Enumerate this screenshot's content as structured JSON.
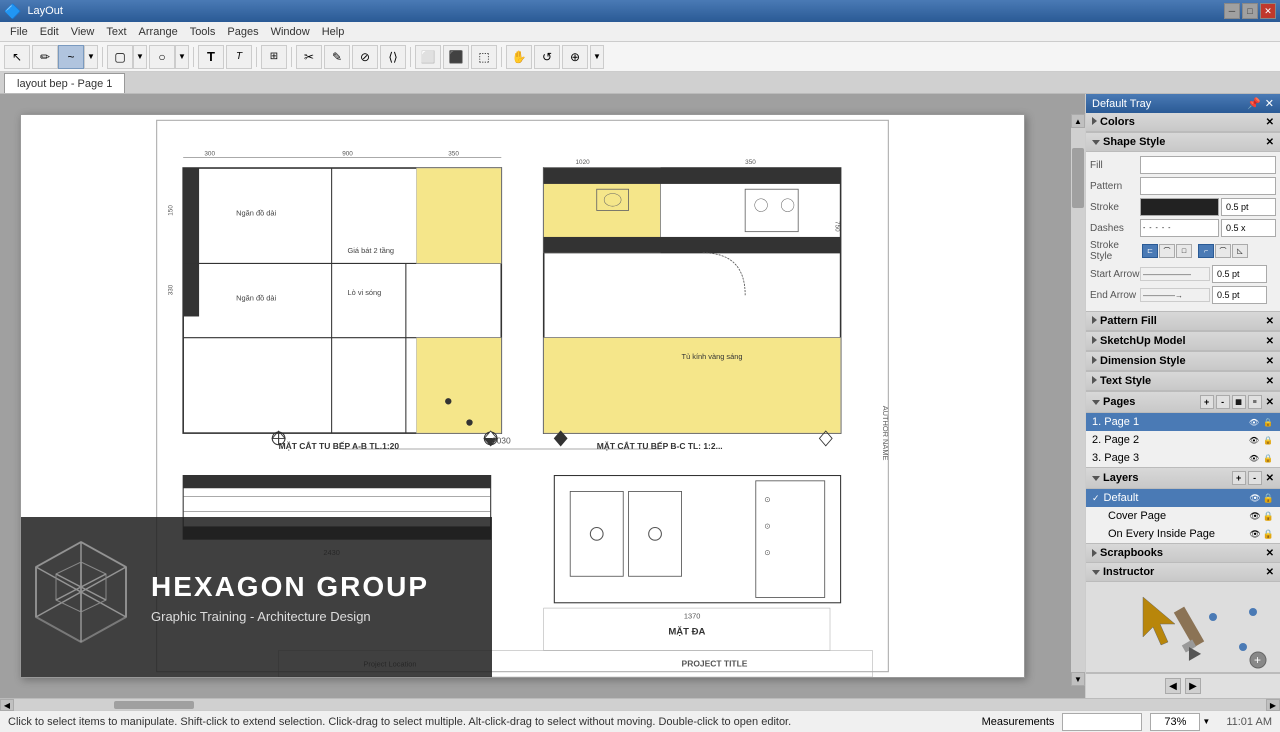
{
  "app": {
    "title": "LayOut",
    "tab_label": "layout bep - Page 1"
  },
  "titlebar": {
    "title": "LayOut",
    "min": "─",
    "max": "□",
    "close": "✕"
  },
  "menubar": {
    "items": [
      "File",
      "Edit",
      "View",
      "Text",
      "Arrange",
      "Tools",
      "Pages",
      "Window",
      "Help"
    ]
  },
  "tabbar": {
    "tabs": [
      "layout bep - Page 1"
    ]
  },
  "toolbar": {
    "tools": [
      "↖",
      "✏",
      "~",
      "▢",
      "⬡",
      "○",
      "◉",
      "T",
      "T2",
      "⊞",
      "✂",
      "✎",
      "⊘",
      "⟨⟩",
      "⬜",
      "⬛",
      "⬚",
      "➤"
    ]
  },
  "tray": {
    "title": "Default Tray",
    "sections": {
      "colors": {
        "label": "Colors",
        "expanded": false
      },
      "shape_style": {
        "label": "Shape Style",
        "expanded": true,
        "fill_label": "Fill",
        "pattern_label": "Pattern",
        "stroke_label": "Stroke",
        "dashes_label": "Dashes",
        "stroke_style_label": "Stroke Style",
        "start_arrow_label": "Start Arrow",
        "end_arrow_label": "End Arrow",
        "stroke_color": "#222222",
        "stroke_pt": "0.5 pt",
        "dashes_val": "0.5 x",
        "start_arrow_val": "0.5 pt",
        "end_arrow_val": "0.5 pt"
      },
      "pattern_fill": {
        "label": "Pattern Fill",
        "expanded": false
      },
      "sketchup_model": {
        "label": "SketchUp Model",
        "expanded": false
      },
      "dimension_style": {
        "label": "Dimension Style",
        "expanded": false
      },
      "text_style": {
        "label": "Text Style",
        "expanded": false
      },
      "pages": {
        "label": "Pages",
        "expanded": true,
        "items": [
          {
            "num": "1",
            "label": "Page 1",
            "active": true
          },
          {
            "num": "2",
            "label": "Page 2",
            "active": false
          },
          {
            "num": "3",
            "label": "Page 3",
            "active": false
          }
        ]
      },
      "layers": {
        "label": "Layers",
        "expanded": true,
        "items": [
          {
            "label": "Default",
            "active": true
          },
          {
            "label": "Cover Page",
            "active": false
          },
          {
            "label": "On Every Inside Page",
            "active": false
          }
        ]
      },
      "scrapbooks": {
        "label": "Scrapbooks",
        "expanded": false
      },
      "instructor": {
        "label": "Instructor",
        "expanded": true
      }
    }
  },
  "statusbar": {
    "hint": "Click to select items to manipulate. Shift-click to extend selection. Click-drag to select multiple. Alt-click-drag to select without moving. Double-click to open editor.",
    "measurements_label": "Measurements",
    "zoom": "73%",
    "time": "11:01 AM"
  },
  "branding": {
    "name": "HEXAGON GROUP",
    "sub": "Graphic Training - Architecture Design"
  },
  "drawing": {
    "title_a": "MẶT CẮT TU BẾP A-B TL.1:20",
    "title_b": "MẶT CẮT TU BẾP B-C TL: 1:2",
    "title_c": "MẶT ĐA",
    "project_loc": "Project Location",
    "project_title": "PROJECT TITLE",
    "side_text": "AUTHOR NAME"
  }
}
